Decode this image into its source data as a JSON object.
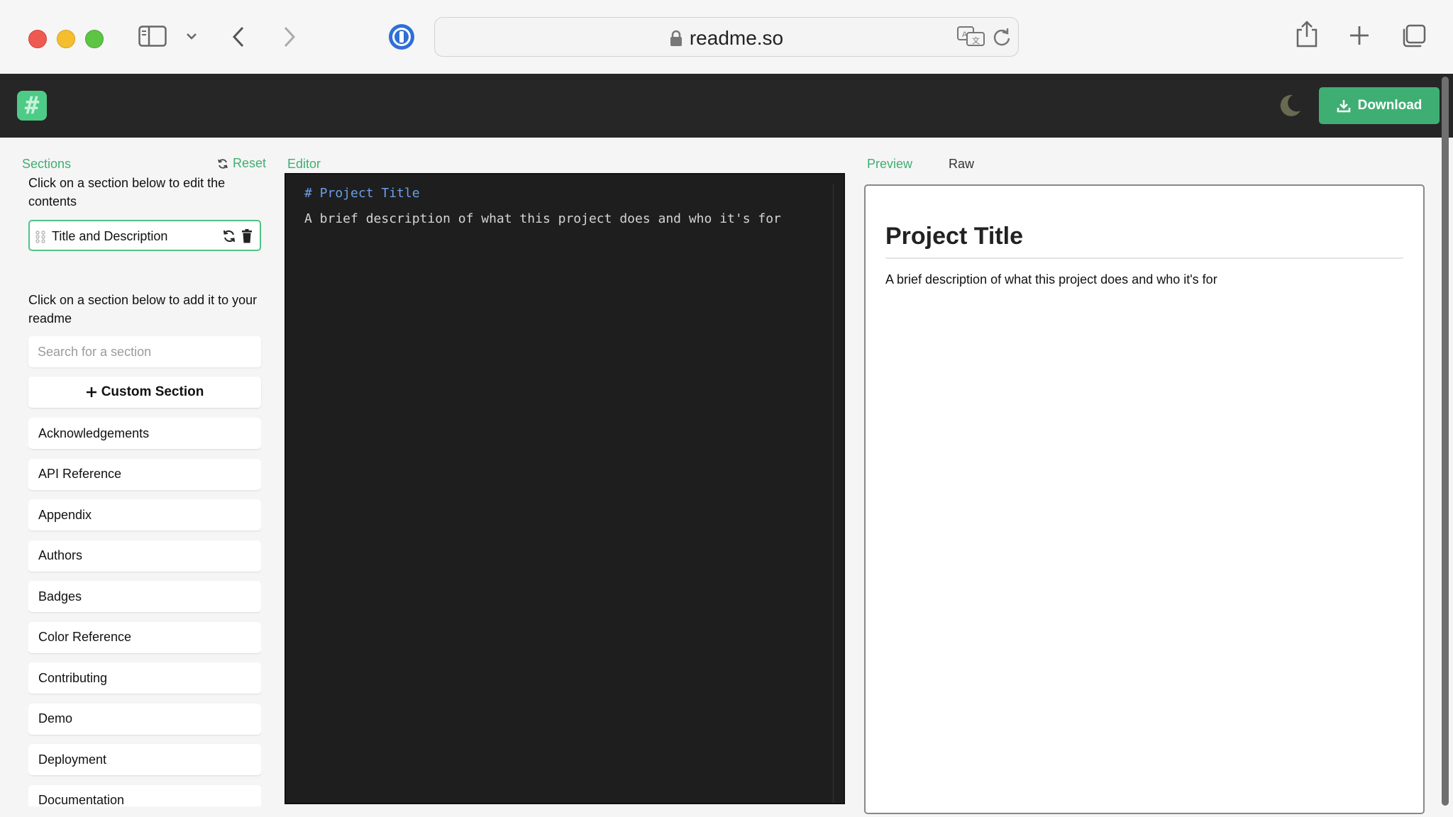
{
  "browser": {
    "url": "readme.so"
  },
  "header": {
    "logo_glyph": "#",
    "download_label": "Download"
  },
  "sections": {
    "title": "Sections",
    "reset_label": "Reset",
    "edit_helper": "Click on a section below to edit the contents",
    "active_items": [
      "Title and Description"
    ],
    "add_helper": "Click on a section below to add it to your readme",
    "search_placeholder": "Search for a section",
    "custom_section_label": "Custom Section",
    "available_items": [
      "Acknowledgements",
      "API Reference",
      "Appendix",
      "Authors",
      "Badges",
      "Color Reference",
      "Contributing",
      "Demo",
      "Deployment",
      "Documentation"
    ]
  },
  "editor": {
    "title": "Editor",
    "lines": [
      "# Project Title",
      "A brief description of what this project does and who it's for"
    ]
  },
  "preview": {
    "tab_preview": "Preview",
    "tab_raw": "Raw",
    "heading": "Project Title",
    "paragraph": "A brief description of what this project does and who it's for"
  },
  "colors": {
    "accent": "#3fae73",
    "header_bg": "#262626",
    "editor_bg": "#1e1e1e",
    "markdown_heading": "#6a9ee8"
  }
}
